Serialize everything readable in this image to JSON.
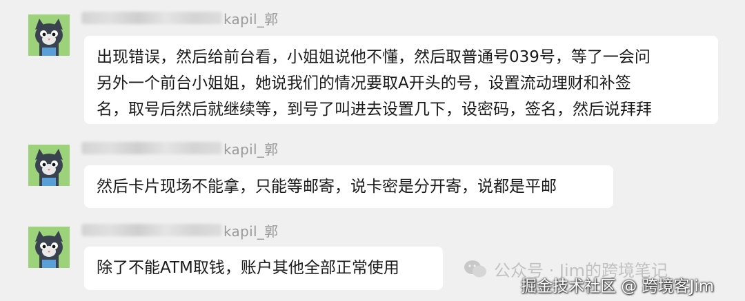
{
  "messages": [
    {
      "sender": "kapil_郭",
      "lines": [
        "出现错误，然后给前台看，小姐姐说他不懂，然后取普通号039号，等了一会问",
        "另外一个前台小姐姐，她说我们的情况要取A开头的号，设置流动理财和补签",
        "名，取号后然后就继续等，到号了叫进去设置几下，设密码，签名，然后说拜拜"
      ]
    },
    {
      "sender": "kapil_郭",
      "lines": [
        "然后卡片现场不能拿，只能等邮寄，说卡密是分开寄，说都是平邮"
      ]
    },
    {
      "sender": "kapil_郭",
      "lines": [
        "除了不能ATM取钱，账户其他全部正常使用"
      ]
    }
  ],
  "watermark": {
    "wechat": "公众号 · Jim的跨境笔记",
    "juejin": "掘金技术社区 @ 跨境客Jim"
  }
}
